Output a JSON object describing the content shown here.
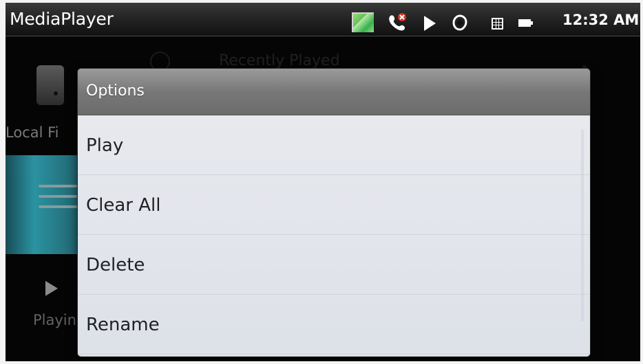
{
  "app": {
    "title": "MediaPlayer"
  },
  "status_bar": {
    "time": "12:32 AM",
    "icons": [
      "gallery-icon",
      "missed-call-icon",
      "play-icon",
      "sync-icon",
      "calendar-icon",
      "battery-icon"
    ]
  },
  "background": {
    "local_files_label": "Local Fi",
    "playing_label": "Playin",
    "recent_label": "Recently Played"
  },
  "dialog": {
    "title": "Options",
    "items": [
      {
        "label": "Play"
      },
      {
        "label": "Clear All"
      },
      {
        "label": "Delete"
      },
      {
        "label": "Rename"
      }
    ]
  },
  "colors": {
    "dialog_background": "#e6e8ed",
    "dialog_header": "#777777",
    "selected_tab_accent": "#2f9fae"
  }
}
